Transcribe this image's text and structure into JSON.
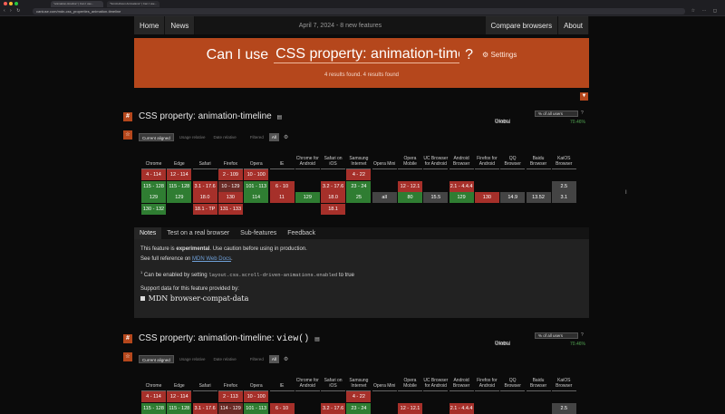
{
  "browser": {
    "tabs": [
      "\"animation-timeline\" | Can I use...",
      "\"Scroll-driven Animations\" | Can I use..."
    ],
    "url": "caniuse.com/mdn-css_properties_animation-timeline"
  },
  "nav": {
    "home": "Home",
    "news": "News",
    "center": "April 7, 2024 - 8 new features",
    "compare": "Compare browsers",
    "about": "About"
  },
  "hero": {
    "prefix": "Can I use",
    "query": "CSS property: animation-timeline",
    "suffix": "?",
    "settings": "Settings",
    "results": "4 results found. 4 results found"
  },
  "features": [
    {
      "title": "CSS property: animation-timeline",
      "title_code": "",
      "usage_label": "Usage",
      "usage_select": "% of all users",
      "help": "?",
      "global_label": "Global",
      "global_pct": "70.46%",
      "toolbar": {
        "current": "Current aligned",
        "relative": "Usage relative",
        "date": "Date relative",
        "filtered": "Filtered",
        "all": "All"
      }
    },
    {
      "title": "CSS property: animation-timeline:",
      "title_code": "view()",
      "usage_label": "Usage",
      "usage_select": "% of all users",
      "help": "?",
      "global_label": "Global",
      "global_pct": "70.46%",
      "toolbar": {
        "current": "Current aligned",
        "relative": "Usage relative",
        "date": "Date relative",
        "filtered": "Filtered",
        "all": "All"
      }
    }
  ],
  "browsers": [
    "Chrome",
    "Edge",
    "Safari",
    "Firefox",
    "Opera",
    "IE",
    "Chrome for Android",
    "Safari on iOS",
    "Samsung Internet",
    "Opera Mini",
    "Opera Mobile",
    "UC Browser for Android",
    "Android Browser",
    "Firefox for Android",
    "QQ Browser",
    "Baidu Browser",
    "KaiOS Browser"
  ],
  "grid1": [
    [
      [
        "4 - 114",
        "r"
      ],
      [
        "115 - 128",
        "g"
      ],
      [
        "129",
        "g"
      ],
      [
        "130 - 132",
        "g"
      ]
    ],
    [
      [
        "12 - 114",
        "r"
      ],
      [
        "115 - 128",
        "g"
      ],
      [
        "129",
        "g"
      ]
    ],
    [
      [
        "",
        "n"
      ],
      [
        "3.1 - 17.6",
        "r"
      ],
      [
        "18.0",
        "r"
      ],
      [
        "18.1 - TP",
        "r"
      ]
    ],
    [
      [
        "2 - 109",
        "r"
      ],
      [
        "10 - 129",
        "p"
      ],
      [
        "130",
        "r"
      ],
      [
        "131 - 133",
        "r"
      ]
    ],
    [
      [
        "10 - 100",
        "r"
      ],
      [
        "101 - 113",
        "g"
      ],
      [
        "114",
        "g"
      ]
    ],
    [
      [
        "",
        "n"
      ],
      [
        "6 - 10",
        "r"
      ],
      [
        "11",
        "r"
      ]
    ],
    [
      [
        "",
        "n"
      ],
      [
        "",
        "n"
      ],
      [
        "129",
        "g"
      ]
    ],
    [
      [
        "",
        "n"
      ],
      [
        "3.2 - 17.6",
        "r"
      ],
      [
        "18.0",
        "r"
      ],
      [
        "18.1",
        "r"
      ]
    ],
    [
      [
        "4 - 22",
        "r"
      ],
      [
        "23 - 24",
        "g"
      ],
      [
        "25",
        "g"
      ]
    ],
    [
      [
        "",
        "n"
      ],
      [
        "",
        "n"
      ],
      [
        "all",
        "gray"
      ]
    ],
    [
      [
        "",
        "n"
      ],
      [
        "12 - 12.1",
        "r"
      ],
      [
        "80",
        "g"
      ]
    ],
    [
      [
        "",
        "n"
      ],
      [
        "",
        "n"
      ],
      [
        "15.5",
        "gray"
      ]
    ],
    [
      [
        "",
        "n"
      ],
      [
        "2.1 - 4.4.4",
        "r"
      ],
      [
        "129",
        "g"
      ]
    ],
    [
      [
        "",
        "n"
      ],
      [
        "",
        "n"
      ],
      [
        "130",
        "r"
      ]
    ],
    [
      [
        "",
        "n"
      ],
      [
        "",
        "n"
      ],
      [
        "14.9",
        "gray"
      ]
    ],
    [
      [
        "",
        "n"
      ],
      [
        "",
        "n"
      ],
      [
        "13.52",
        "gray"
      ]
    ],
    [
      [
        "",
        "n"
      ],
      [
        "2.5",
        "gray"
      ],
      [
        "3.1",
        "gray"
      ]
    ]
  ],
  "grid2": [
    [
      [
        "4 - 114",
        "r"
      ],
      [
        "115 - 128",
        "g"
      ]
    ],
    [
      [
        "12 - 114",
        "r"
      ],
      [
        "115 - 128",
        "g"
      ]
    ],
    [
      [
        "",
        "n"
      ],
      [
        "3.1 - 17.6",
        "r"
      ]
    ],
    [
      [
        "2 - 113",
        "r"
      ],
      [
        "114 - 129",
        "p"
      ]
    ],
    [
      [
        "10 - 100",
        "r"
      ],
      [
        "101 - 113",
        "g"
      ]
    ],
    [
      [
        "",
        "n"
      ],
      [
        "6 - 10",
        "r"
      ]
    ],
    [
      [
        "",
        "n"
      ],
      [
        "",
        "n"
      ]
    ],
    [
      [
        "",
        "n"
      ],
      [
        "3.2 - 17.6",
        "r"
      ]
    ],
    [
      [
        "4 - 22",
        "r"
      ],
      [
        "23 - 24",
        "g"
      ]
    ],
    [
      [
        "",
        "n"
      ],
      [
        "",
        "n"
      ]
    ],
    [
      [
        "",
        "n"
      ],
      [
        "12 - 12.1",
        "r"
      ]
    ],
    [
      [
        "",
        "n"
      ],
      [
        "",
        "n"
      ]
    ],
    [
      [
        "",
        "n"
      ],
      [
        "2.1 - 4.4.4",
        "r"
      ]
    ],
    [
      [
        "",
        "n"
      ],
      [
        "",
        "n"
      ]
    ],
    [
      [
        "",
        "n"
      ],
      [
        "",
        "n"
      ]
    ],
    [
      [
        "",
        "n"
      ],
      [
        "",
        "n"
      ]
    ],
    [
      [
        "",
        "n"
      ],
      [
        "2.5",
        "gray"
      ]
    ]
  ],
  "notes_tabs": [
    "Notes",
    "Test on a real browser",
    "Sub-features",
    "Feedback"
  ],
  "notes": {
    "line1_pre": "This feature is",
    "line1_bold": "experimental",
    "line1_post": ". Use caution before using in production.",
    "line2_pre": "See full reference on",
    "line2_link": "MDN Web Docs",
    "line2_post": ".",
    "line3_badge": "1",
    "line3_pre": "Can be enabled by setting",
    "line3_code": "layout.css.scroll-driven-animations.enabled",
    "line3_post": "to true",
    "line4": "Support data for this feature provided by:",
    "mdn": "MDN browser-compat-data"
  }
}
